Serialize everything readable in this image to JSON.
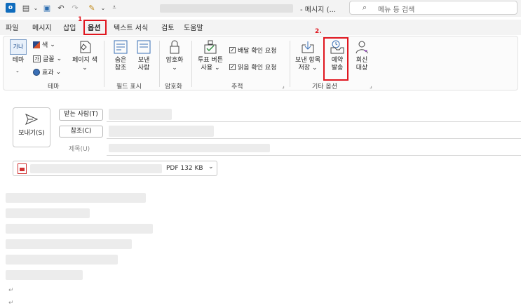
{
  "titlebar": {
    "title_suffix": "- 메시지 (...",
    "search_placeholder": "메뉴 등 검색"
  },
  "menu": {
    "tabs": [
      {
        "label": "파일"
      },
      {
        "label": "메시지"
      },
      {
        "label": "삽입"
      },
      {
        "label": "옵션"
      },
      {
        "label": "텍스트 서식"
      },
      {
        "label": "검토"
      },
      {
        "label": "도움말"
      }
    ],
    "active_tab": "옵션"
  },
  "annotations": {
    "step1": "1",
    "step2": "2."
  },
  "ribbon": {
    "theme_group": {
      "theme_btn": "테마",
      "theme_icon_text": "가나",
      "color": "색",
      "font": "글꼴",
      "effect": "효과",
      "page_color_line1": "페이지 색",
      "label": "테마"
    },
    "fields_group": {
      "hidden_cc_line1": "숨은",
      "hidden_cc_line2": "참조",
      "from_line1": "보낸",
      "from_line2": "사람",
      "label": "필드 표시"
    },
    "encrypt_group": {
      "encrypt": "암호화",
      "label": "암호화"
    },
    "tracking_group": {
      "vote_line1": "투표 버튼",
      "vote_line2": "사용",
      "delivery": "배달 확인 요청",
      "read": "읽음 확인 요청",
      "label": "추적"
    },
    "more_group": {
      "save_sent_line1": "보낸 항목",
      "save_sent_line2": "저장",
      "delay_line1": "예약",
      "delay_line2": "발송",
      "reply_line1": "회신",
      "reply_line2": "대상",
      "label": "기타 옵션"
    }
  },
  "compose": {
    "send": "보내기(S)",
    "to_btn": "받는 사람(T)",
    "cc_btn": "참조(C)",
    "subject_label": "제목(U)",
    "attachment_type": "PDF",
    "attachment_size": "132 KB",
    "paragraph_mark": "↵"
  },
  "colors": {
    "accent": "#0f6cbd",
    "highlight": "#e0161f"
  }
}
